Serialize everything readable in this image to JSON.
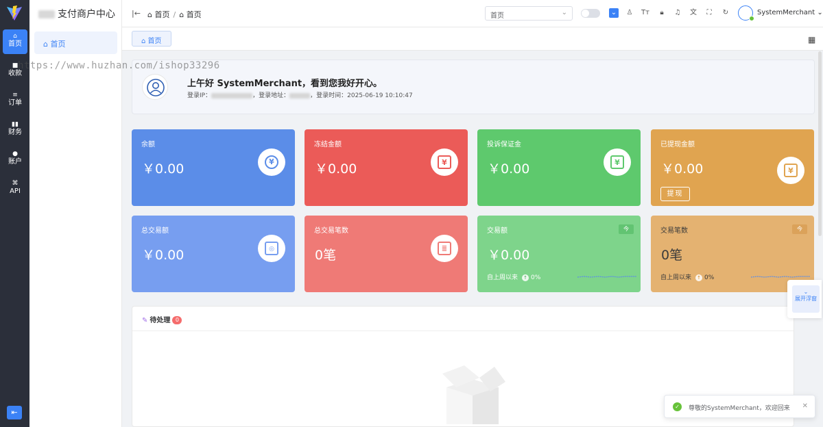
{
  "rail": {
    "logo_icon": "vite-logo",
    "items": [
      {
        "label": "首页",
        "icon": "home-icon",
        "active": true
      },
      {
        "label": "收款",
        "icon": "wallet-icon"
      },
      {
        "label": "订单",
        "icon": "list-icon"
      },
      {
        "label": "财务",
        "icon": "finance-icon"
      },
      {
        "label": "账户",
        "icon": "user-icon"
      },
      {
        "label": "API",
        "icon": "api-icon"
      }
    ],
    "collapse_icon": "collapse-icon"
  },
  "sidebar": {
    "title": "支付商户中心",
    "items": [
      {
        "label": "首页",
        "icon": "home-icon"
      }
    ]
  },
  "header": {
    "breadcrumb": [
      "首页",
      "首页"
    ],
    "select_value": "首页",
    "user_name": "SystemMerchant"
  },
  "tabs": [
    {
      "label": "首页"
    }
  ],
  "welcome": {
    "greeting": "上午好 SystemMerchant，看到您我好开心。",
    "ip_label": "登录IP：",
    "addr_label": "，登录地址：",
    "time_label": "，登录时间：",
    "login_time": "2025-06-19 10:10:47"
  },
  "cards": [
    {
      "label": "余额",
      "value": "￥0.00",
      "color": "#5b8de8",
      "icon": "yen-circle-icon"
    },
    {
      "label": "冻结金额",
      "value": "￥0.00",
      "color": "#eb5b58",
      "icon": "yen-box-icon"
    },
    {
      "label": "投诉保证金",
      "value": "￥0.00",
      "color": "#5ec96d",
      "icon": "yen-box-icon"
    },
    {
      "label": "已提现金额",
      "value": "￥0.00",
      "color": "#e0a450",
      "icon": "yen-box-icon",
      "button": "提现"
    },
    {
      "label": "总交易额",
      "value": "￥0.00",
      "color": "#779ef0",
      "icon": "device-icon"
    },
    {
      "label": "总交易笔数",
      "value": "0笔",
      "color": "#ef7a76",
      "icon": "document-icon"
    },
    {
      "label": "交易额",
      "value": "￥0.00",
      "color": "#7ed48b",
      "sub_label": "自上周以来",
      "sub_value": "0%",
      "tag": "今"
    },
    {
      "label": "交易笔数",
      "value": "0笔",
      "color": "#e4b271",
      "sub_label": "自上周以来",
      "sub_value": "0%",
      "tag": "今"
    }
  ],
  "pending": {
    "title": "待处理",
    "count": "0"
  },
  "float": {
    "label": "展开浮窗"
  },
  "toast": {
    "text": "尊敬的SystemMerchant，欢迎回来"
  },
  "watermark": "https://www.huzhan.com/ishop33296"
}
